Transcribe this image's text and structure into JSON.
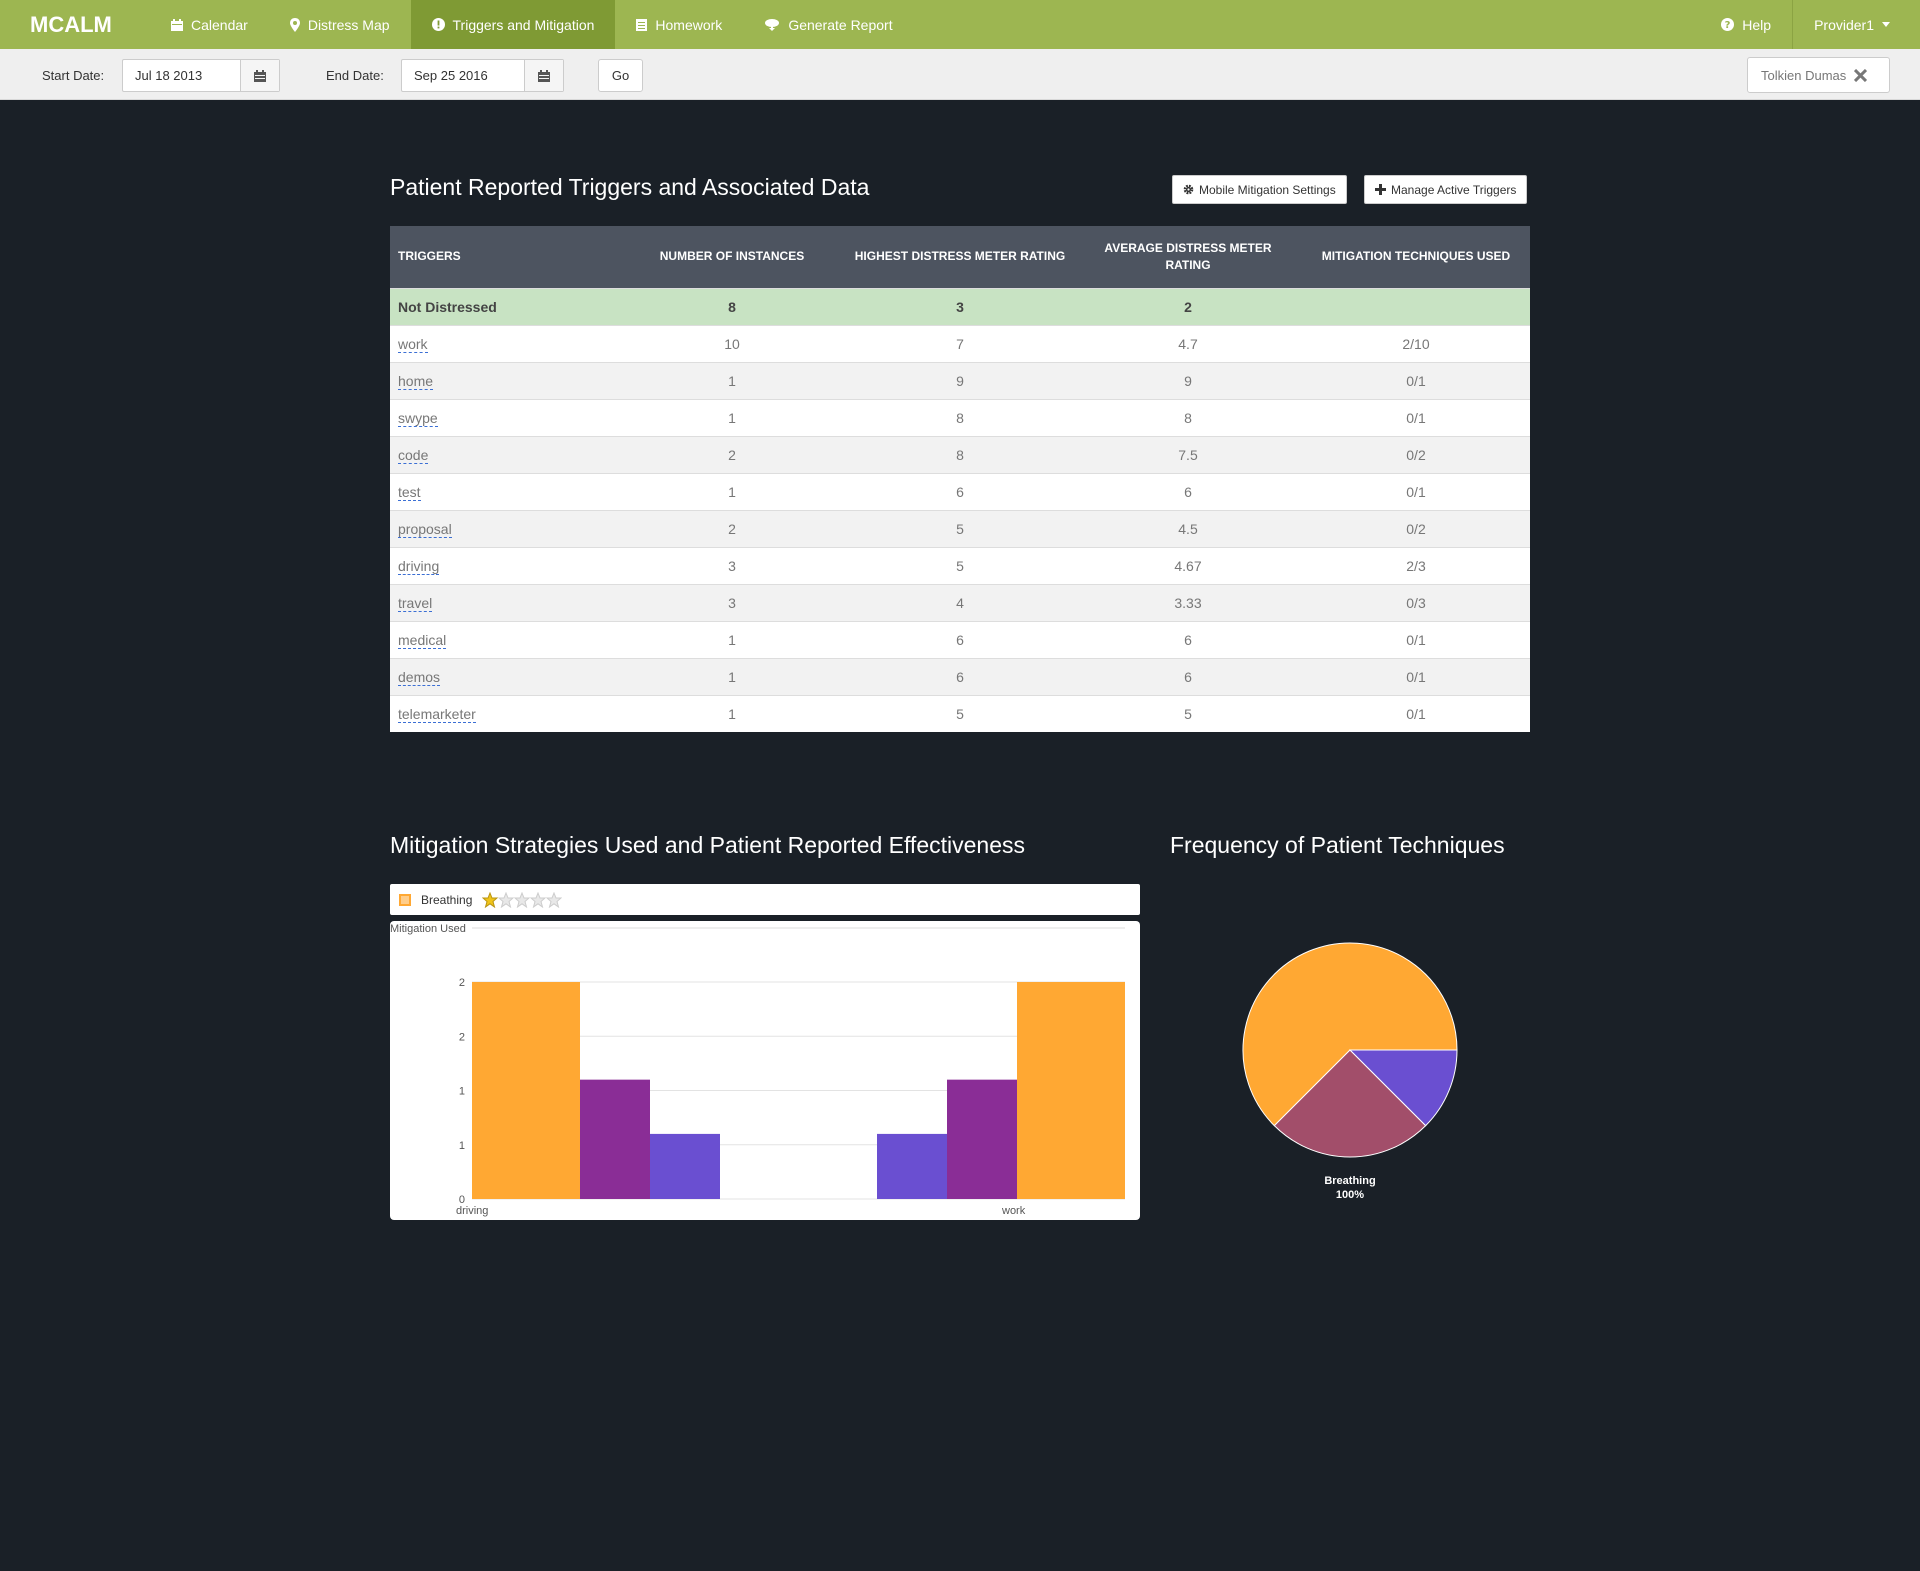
{
  "nav": {
    "brand": "MCALM",
    "items": [
      {
        "label": "Calendar",
        "icon": "calendar-icon",
        "active": false
      },
      {
        "label": "Distress Map",
        "icon": "map-marker-icon",
        "active": false
      },
      {
        "label": "Triggers and Mitigation",
        "icon": "exclamation-circle-icon",
        "active": true
      },
      {
        "label": "Homework",
        "icon": "list-icon",
        "active": false
      },
      {
        "label": "Generate Report",
        "icon": "cloud-download-icon",
        "active": false
      }
    ],
    "help": "Help",
    "user": "Provider1"
  },
  "toolbar": {
    "start_label": "Start Date:",
    "start_value": "Jul 18 2013",
    "end_label": "End Date:",
    "end_value": "Sep 25 2016",
    "go_label": "Go",
    "patient_name": "Tolkien Dumas"
  },
  "triggers": {
    "title": "Patient Reported Triggers and Associated Data",
    "settings_btn": "Mobile Mitigation Settings",
    "manage_btn": "Manage Active Triggers",
    "headers": [
      "Triggers",
      "Number of Instances",
      "Highest Distress Meter Rating",
      "Average Distress Meter Rating",
      "Mitigation Techniques Used"
    ],
    "summary": {
      "name": "Not Distressed",
      "instances": "8",
      "highest": "3",
      "average": "2",
      "mitigation": ""
    },
    "rows": [
      {
        "name": "work",
        "instances": "10",
        "highest": "7",
        "average": "4.7",
        "mitigation": "2/10"
      },
      {
        "name": "home",
        "instances": "1",
        "highest": "9",
        "average": "9",
        "mitigation": "0/1"
      },
      {
        "name": "swype",
        "instances": "1",
        "highest": "8",
        "average": "8",
        "mitigation": "0/1"
      },
      {
        "name": "code",
        "instances": "2",
        "highest": "8",
        "average": "7.5",
        "mitigation": "0/2"
      },
      {
        "name": "test",
        "instances": "1",
        "highest": "6",
        "average": "6",
        "mitigation": "0/1"
      },
      {
        "name": "proposal",
        "instances": "2",
        "highest": "5",
        "average": "4.5",
        "mitigation": "0/2"
      },
      {
        "name": "driving",
        "instances": "3",
        "highest": "5",
        "average": "4.67",
        "mitigation": "2/3"
      },
      {
        "name": "travel",
        "instances": "3",
        "highest": "4",
        "average": "3.33",
        "mitigation": "0/3"
      },
      {
        "name": "medical",
        "instances": "1",
        "highest": "6",
        "average": "6",
        "mitigation": "0/1"
      },
      {
        "name": "demos",
        "instances": "1",
        "highest": "6",
        "average": "6",
        "mitigation": "0/1"
      },
      {
        "name": "telemarketer",
        "instances": "1",
        "highest": "5",
        "average": "5",
        "mitigation": "0/1"
      }
    ]
  },
  "mitigation": {
    "title": "Mitigation Strategies Used and Patient Reported Effectiveness",
    "legend_label": "Breathing",
    "rating": 1,
    "rating_max": 5
  },
  "frequency": {
    "title": "Frequency of Patient Techniques"
  },
  "chart_data": [
    {
      "type": "bar",
      "title": "",
      "ylabel": "Mitigation Used",
      "categories": [
        "driving",
        "work"
      ],
      "ylim": [
        0,
        2
      ],
      "ytick_labels": [
        "0",
        "1",
        "1",
        "2",
        "2"
      ],
      "series": [
        {
          "name": "Breathing",
          "color": "#ffa833",
          "values": [
            2,
            2
          ]
        },
        {
          "color": "#8a2d96",
          "values": [
            1.1,
            1.1
          ]
        },
        {
          "color": "#6a4fd1",
          "values": [
            0.6,
            0.6
          ]
        }
      ],
      "legend": "top"
    },
    {
      "type": "pie",
      "title": "",
      "slices": [
        {
          "label": "Breathing",
          "percent_label": "100%",
          "value": 62.5,
          "color": "#ffa833"
        },
        {
          "value": 25,
          "color": "#a24e6a"
        },
        {
          "value": 12.5,
          "color": "#6a4fd1"
        }
      ]
    }
  ]
}
